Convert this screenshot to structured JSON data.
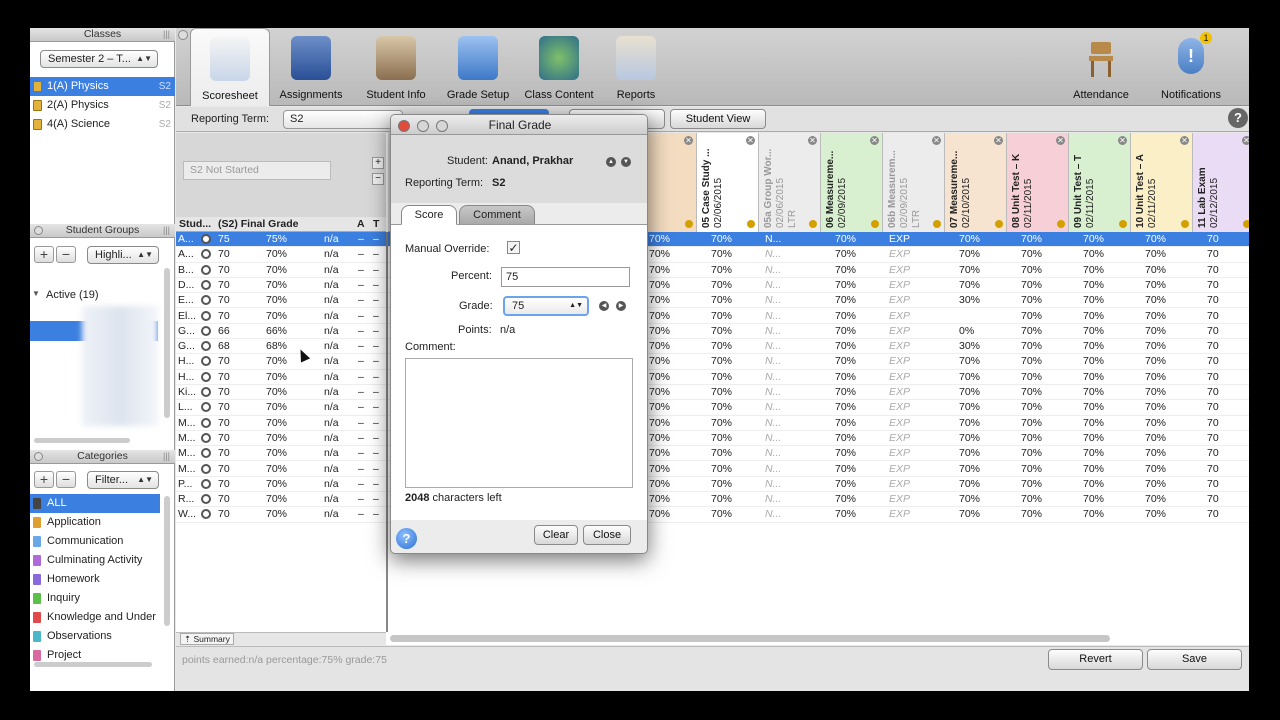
{
  "sidebar": {
    "classes_header": "Classes",
    "semester": "Semester 2 – T...",
    "classes": [
      {
        "name": "1(A) Physics",
        "tag": "S2"
      },
      {
        "name": "2(A) Physics",
        "tag": "S2"
      },
      {
        "name": "4(A) Science",
        "tag": "S2"
      }
    ],
    "groups_header": "Student Groups",
    "groups_filter": "Highli...",
    "active_label": "Active (19)",
    "categories_header": "Categories",
    "categories_filter": "Filter...",
    "categories": [
      {
        "name": "ALL",
        "color": "#444444"
      },
      {
        "name": "Application",
        "color": "#e0a030"
      },
      {
        "name": "Communication",
        "color": "#6aa8e8"
      },
      {
        "name": "Culminating Activity",
        "color": "#b06ad8"
      },
      {
        "name": "Homework",
        "color": "#8a6ad8"
      },
      {
        "name": "Inquiry",
        "color": "#5ac04a"
      },
      {
        "name": "Knowledge and Under",
        "color": "#e04a4a"
      },
      {
        "name": "Observations",
        "color": "#4ab8c8"
      },
      {
        "name": "Project",
        "color": "#d86aa0"
      }
    ]
  },
  "toolbar": {
    "items": [
      "Scoresheet",
      "Assignments",
      "Student Info",
      "Grade Setup",
      "Class Content",
      "Reports"
    ],
    "right_items": [
      "Attendance",
      "Notifications"
    ],
    "notification_count": "1",
    "help": "?"
  },
  "bar2": {
    "reporting_term_label": "Reporting Term:",
    "reporting_term_value": "S2",
    "student_view": "Student View"
  },
  "grid": {
    "status": "S2 Not Started",
    "headers": {
      "student": "Stud...",
      "final": "(S2) Final Grade",
      "a": "A",
      "t": "T"
    },
    "columns": [
      {
        "name": "",
        "date": "02/05/2015",
        "style": "norm",
        "bg": "#f3dcc0"
      },
      {
        "name": "05 Case Study ...",
        "date": "02/06/2015",
        "style": "norm",
        "bg": "#ffffff"
      },
      {
        "name": "05a Group Wor...",
        "date": "02/06/2015",
        "extra": "LTR",
        "style": "gray",
        "bg": "#ececec"
      },
      {
        "name": "06 Measureme...",
        "date": "02/09/2015",
        "style": "norm",
        "bg": "#d8f0d0"
      },
      {
        "name": "06b Measurem...",
        "date": "02/09/2015",
        "extra": "LTR",
        "style": "gray",
        "bg": "#ececec"
      },
      {
        "name": "07 Measureme...",
        "date": "02/10/2015",
        "style": "norm",
        "bg": "#f6e4d0"
      },
      {
        "name": "08 Unit Test – K",
        "date": "02/11/2015",
        "style": "norm",
        "bg": "#f6d0d6"
      },
      {
        "name": "09 Unit Test – T",
        "date": "02/11/2015",
        "style": "norm",
        "bg": "#d8f0d0"
      },
      {
        "name": "10 Unit Test – A",
        "date": "02/11/2015",
        "style": "norm",
        "bg": "#fbefc8"
      },
      {
        "name": "11 Lab Exam",
        "date": "02/12/2015",
        "style": "norm",
        "bg": "#eadcf4"
      }
    ],
    "rows": [
      {
        "s": "A...",
        "g": "75",
        "p": "75%",
        "c": [
          "70%",
          "70%",
          "N...",
          "70%",
          "EXP",
          "70%",
          "70%",
          "70%",
          "70%",
          "70"
        ]
      },
      {
        "s": "A...",
        "g": "70",
        "p": "70%",
        "c": [
          "70%",
          "70%",
          "N...",
          "70%",
          "EXP",
          "70%",
          "70%",
          "70%",
          "70%",
          "70"
        ]
      },
      {
        "s": "B...",
        "g": "70",
        "p": "70%",
        "c": [
          "70%",
          "70%",
          "N...",
          "70%",
          "EXP",
          "70%",
          "70%",
          "70%",
          "70%",
          "70"
        ]
      },
      {
        "s": "D...",
        "g": "70",
        "p": "70%",
        "c": [
          "70%",
          "70%",
          "N...",
          "70%",
          "EXP",
          "70%",
          "70%",
          "70%",
          "70%",
          "70"
        ]
      },
      {
        "s": "E...",
        "g": "70",
        "p": "70%",
        "c": [
          "70%",
          "70%",
          "N...",
          "70%",
          "EXP",
          "30%",
          "70%",
          "70%",
          "70%",
          "70"
        ]
      },
      {
        "s": "El...",
        "g": "70",
        "p": "70%",
        "c": [
          "70%",
          "70%",
          "N...",
          "70%",
          "EXP",
          "",
          "70%",
          "70%",
          "70%",
          "70"
        ]
      },
      {
        "s": "G...",
        "g": "66",
        "p": "66%",
        "c": [
          "70%",
          "70%",
          "N...",
          "70%",
          "EXP",
          "0%",
          "70%",
          "70%",
          "70%",
          "70"
        ]
      },
      {
        "s": "G...",
        "g": "68",
        "p": "68%",
        "c": [
          "70%",
          "70%",
          "N...",
          "70%",
          "EXP",
          "30%",
          "70%",
          "70%",
          "70%",
          "70"
        ]
      },
      {
        "s": "H...",
        "g": "70",
        "p": "70%",
        "c": [
          "70%",
          "70%",
          "N...",
          "70%",
          "EXP",
          "70%",
          "70%",
          "70%",
          "70%",
          "70"
        ]
      },
      {
        "s": "H...",
        "g": "70",
        "p": "70%",
        "c": [
          "70%",
          "70%",
          "N...",
          "70%",
          "EXP",
          "70%",
          "70%",
          "70%",
          "70%",
          "70"
        ]
      },
      {
        "s": "Ki...",
        "g": "70",
        "p": "70%",
        "c": [
          "70%",
          "70%",
          "N...",
          "70%",
          "EXP",
          "70%",
          "70%",
          "70%",
          "70%",
          "70"
        ]
      },
      {
        "s": "L...",
        "g": "70",
        "p": "70%",
        "c": [
          "70%",
          "70%",
          "N...",
          "70%",
          "EXP",
          "70%",
          "70%",
          "70%",
          "70%",
          "70"
        ]
      },
      {
        "s": "M...",
        "g": "70",
        "p": "70%",
        "c": [
          "70%",
          "70%",
          "N...",
          "70%",
          "EXP",
          "70%",
          "70%",
          "70%",
          "70%",
          "70"
        ]
      },
      {
        "s": "M...",
        "g": "70",
        "p": "70%",
        "c": [
          "70%",
          "70%",
          "N...",
          "70%",
          "EXP",
          "70%",
          "70%",
          "70%",
          "70%",
          "70"
        ]
      },
      {
        "s": "M...",
        "g": "70",
        "p": "70%",
        "c": [
          "70%",
          "70%",
          "N...",
          "70%",
          "EXP",
          "70%",
          "70%",
          "70%",
          "70%",
          "70"
        ]
      },
      {
        "s": "M...",
        "g": "70",
        "p": "70%",
        "c": [
          "70%",
          "70%",
          "N...",
          "70%",
          "EXP",
          "70%",
          "70%",
          "70%",
          "70%",
          "70"
        ]
      },
      {
        "s": "P...",
        "g": "70",
        "p": "70%",
        "c": [
          "70%",
          "70%",
          "N...",
          "70%",
          "EXP",
          "70%",
          "70%",
          "70%",
          "70%",
          "70"
        ]
      },
      {
        "s": "R...",
        "g": "70",
        "p": "70%",
        "c": [
          "70%",
          "70%",
          "N...",
          "70%",
          "EXP",
          "70%",
          "70%",
          "70%",
          "70%",
          "70"
        ]
      },
      {
        "s": "W...",
        "g": "70",
        "p": "70%",
        "c": [
          "70%",
          "70%",
          "N...",
          "70%",
          "EXP",
          "70%",
          "70%",
          "70%",
          "70%",
          "70"
        ]
      }
    ],
    "na": "n/a",
    "dash": "–",
    "summary": "Summary"
  },
  "status_bar": "points earned:n/a  percentage:75%  grade:75",
  "buttons": {
    "revert": "Revert",
    "save": "Save"
  },
  "dialog": {
    "title": "Final Grade",
    "student_label": "Student:",
    "student_name": "Anand, Prakhar",
    "term_label": "Reporting Term:",
    "term_value": "S2",
    "tab_score": "Score",
    "tab_comment": "Comment",
    "override_label": "Manual Override:",
    "override_checked": "✓",
    "percent_label": "Percent:",
    "percent_value": "75",
    "grade_label": "Grade:",
    "grade_value": "75",
    "points_label": "Points:",
    "points_value": "n/a",
    "comment_label": "Comment:",
    "chars_count": "2048",
    "chars_left": "characters left",
    "clear": "Clear",
    "close": "Close",
    "help": "?"
  }
}
